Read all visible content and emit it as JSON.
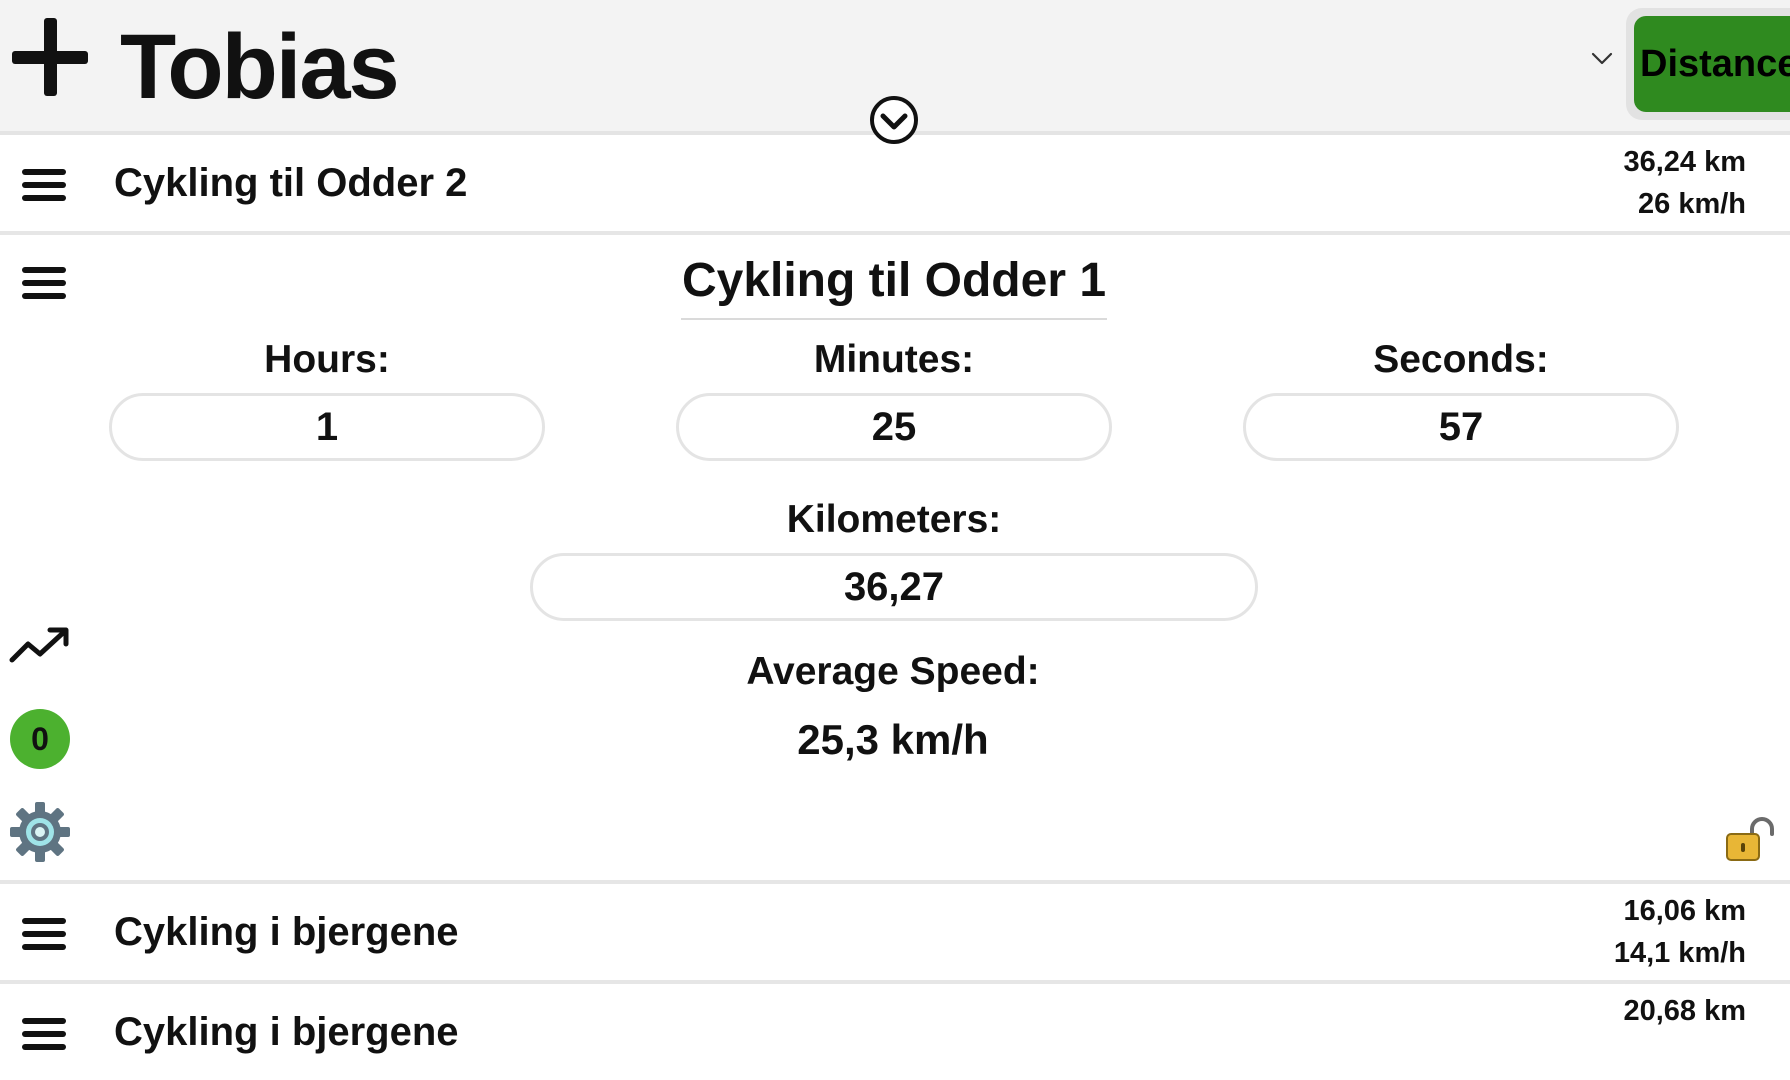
{
  "header": {
    "add_icon": "plus-icon",
    "title": "Tobias",
    "collapse_icon": "chevron-down-circle-icon",
    "select_chevron_icon": "chevron-down-icon",
    "mode_button_label": "Distance",
    "mode_button_color": "#2f8a1f"
  },
  "rows": [
    {
      "title": "Cykling til Odder 2",
      "distance": "36,24 km",
      "speed": "26 km/h"
    },
    {
      "title": "Cykling i bjergene",
      "distance": "16,06 km",
      "speed": "14,1 km/h"
    },
    {
      "title": "Cykling i bjergene",
      "distance": "20,68 km",
      "speed": ""
    }
  ],
  "expanded_entry": {
    "title": "Cykling til Odder 1",
    "hours_label": "Hours:",
    "hours_value": "1",
    "minutes_label": "Minutes:",
    "minutes_value": "25",
    "seconds_label": "Seconds:",
    "seconds_value": "57",
    "kilometers_label": "Kilometers:",
    "kilometers_value": "36,27",
    "average_speed_label": "Average Speed:",
    "average_speed_value": "25,3 km/h",
    "count_badge": "0",
    "badge_color": "#4cb12f",
    "side_icons": [
      "menu-icon",
      "trend-up-icon",
      "gear-icon"
    ],
    "lock_icon": "lock-open-icon"
  }
}
